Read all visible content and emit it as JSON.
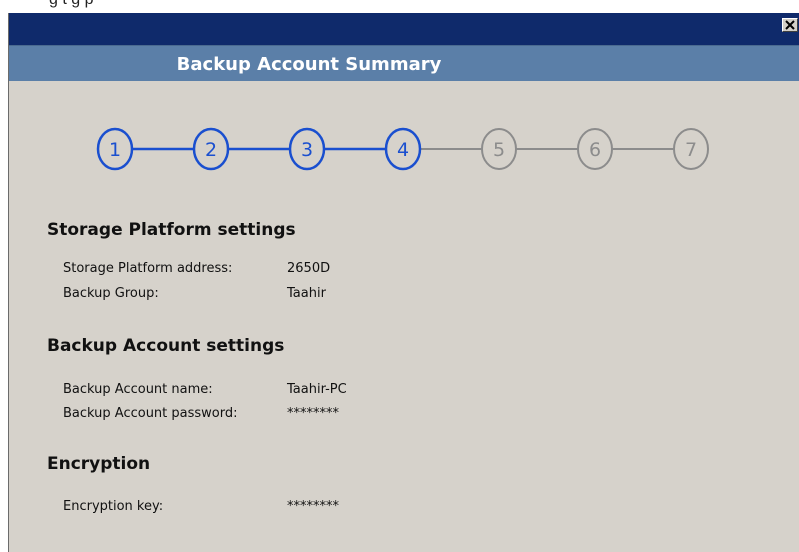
{
  "window": {
    "caption_fragment": "g   t   g   p",
    "close_label": "×"
  },
  "header": {
    "title": "Backup Account Summary"
  },
  "steps": [
    {
      "label": "1",
      "state": "active"
    },
    {
      "label": "2",
      "state": "active"
    },
    {
      "label": "3",
      "state": "active"
    },
    {
      "label": "4",
      "state": "active"
    },
    {
      "label": "5",
      "state": "inactive"
    },
    {
      "label": "6",
      "state": "inactive"
    },
    {
      "label": "7",
      "state": "inactive"
    }
  ],
  "colors": {
    "active": "#1a4fcf",
    "inactive": "#8c8c8c"
  },
  "sections": {
    "storage": {
      "title": "Storage Platform settings",
      "address_label": "Storage Platform address:",
      "address_value": "2650D",
      "group_label": "Backup Group:",
      "group_value": "Taahir"
    },
    "account": {
      "title": "Backup Account settings",
      "name_label": "Backup Account name:",
      "name_value": "Taahir-PC",
      "password_label": "Backup Account password:",
      "password_value": "********"
    },
    "encryption": {
      "title": "Encryption",
      "key_label": "Encryption key:",
      "key_value": "********"
    }
  }
}
